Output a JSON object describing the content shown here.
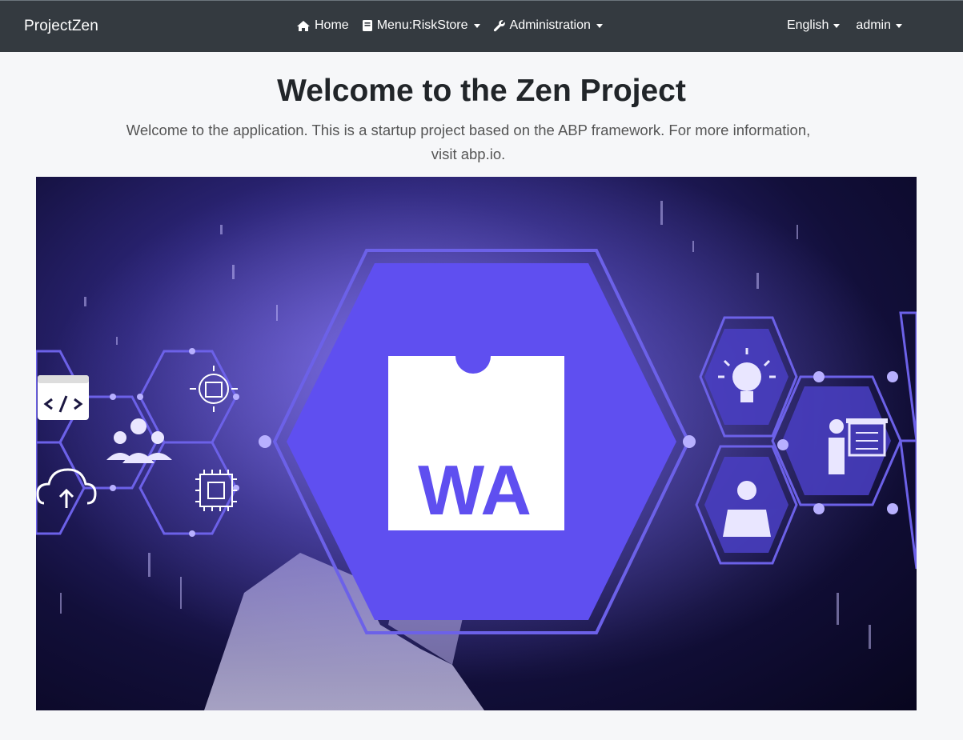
{
  "navbar": {
    "brand": "ProjectZen",
    "items": [
      {
        "label": "Home",
        "icon": "home-icon"
      },
      {
        "label": "Menu:RiskStore",
        "icon": "book-icon",
        "dropdown": true
      },
      {
        "label": "Administration",
        "icon": "wrench-icon",
        "dropdown": true
      }
    ],
    "language": "English",
    "user": "admin"
  },
  "hero": {
    "title": "Welcome to the Zen Project",
    "text": "Welcome to the application. This is a startup project based on the ABP framework. For more information, visit abp.io.",
    "banner_logo_text": "WA"
  },
  "colors": {
    "navbar_bg": "#343a40",
    "page_bg": "#f6f7f9",
    "accent_purple": "#5f4ff0"
  }
}
